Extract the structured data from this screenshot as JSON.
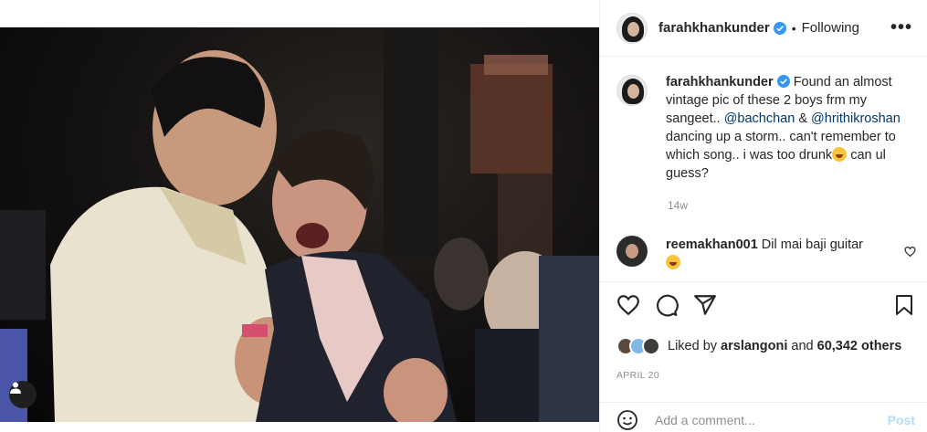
{
  "post": {
    "username": "farahkhankunder",
    "follow_status": "Following",
    "more_label": "•••",
    "caption": {
      "username": "farahkhankunder",
      "text_1": "Found an almost vintage pic of these 2 boys frm my sangeet..",
      "mention_1": "@bachchan",
      "text_2": "&",
      "mention_2": "@hrithikroshan",
      "text_3": "dancing up a storm.. can't remember to which song.. i was too drunk",
      "text_4": "can ul guess?"
    },
    "time_ago": "14w"
  },
  "comments": [
    {
      "username": "reemakhan001",
      "text": "Dil mai baji guitar"
    }
  ],
  "likes": {
    "prefix": "Liked by",
    "user": "arslangoni",
    "and": "and",
    "count": "60,342 others"
  },
  "date": "APRIL 20",
  "add_comment": {
    "placeholder": "Add a comment...",
    "post_label": "Post"
  },
  "colors": {
    "accent": "#0095f6",
    "verified": "#3897f0",
    "link": "#00376b",
    "muted": "#8e8e8e"
  },
  "icons": [
    "heart-icon",
    "comment-icon",
    "share-icon",
    "bookmark-icon",
    "smile-icon",
    "verified-badge-icon",
    "tag-user-icon"
  ]
}
